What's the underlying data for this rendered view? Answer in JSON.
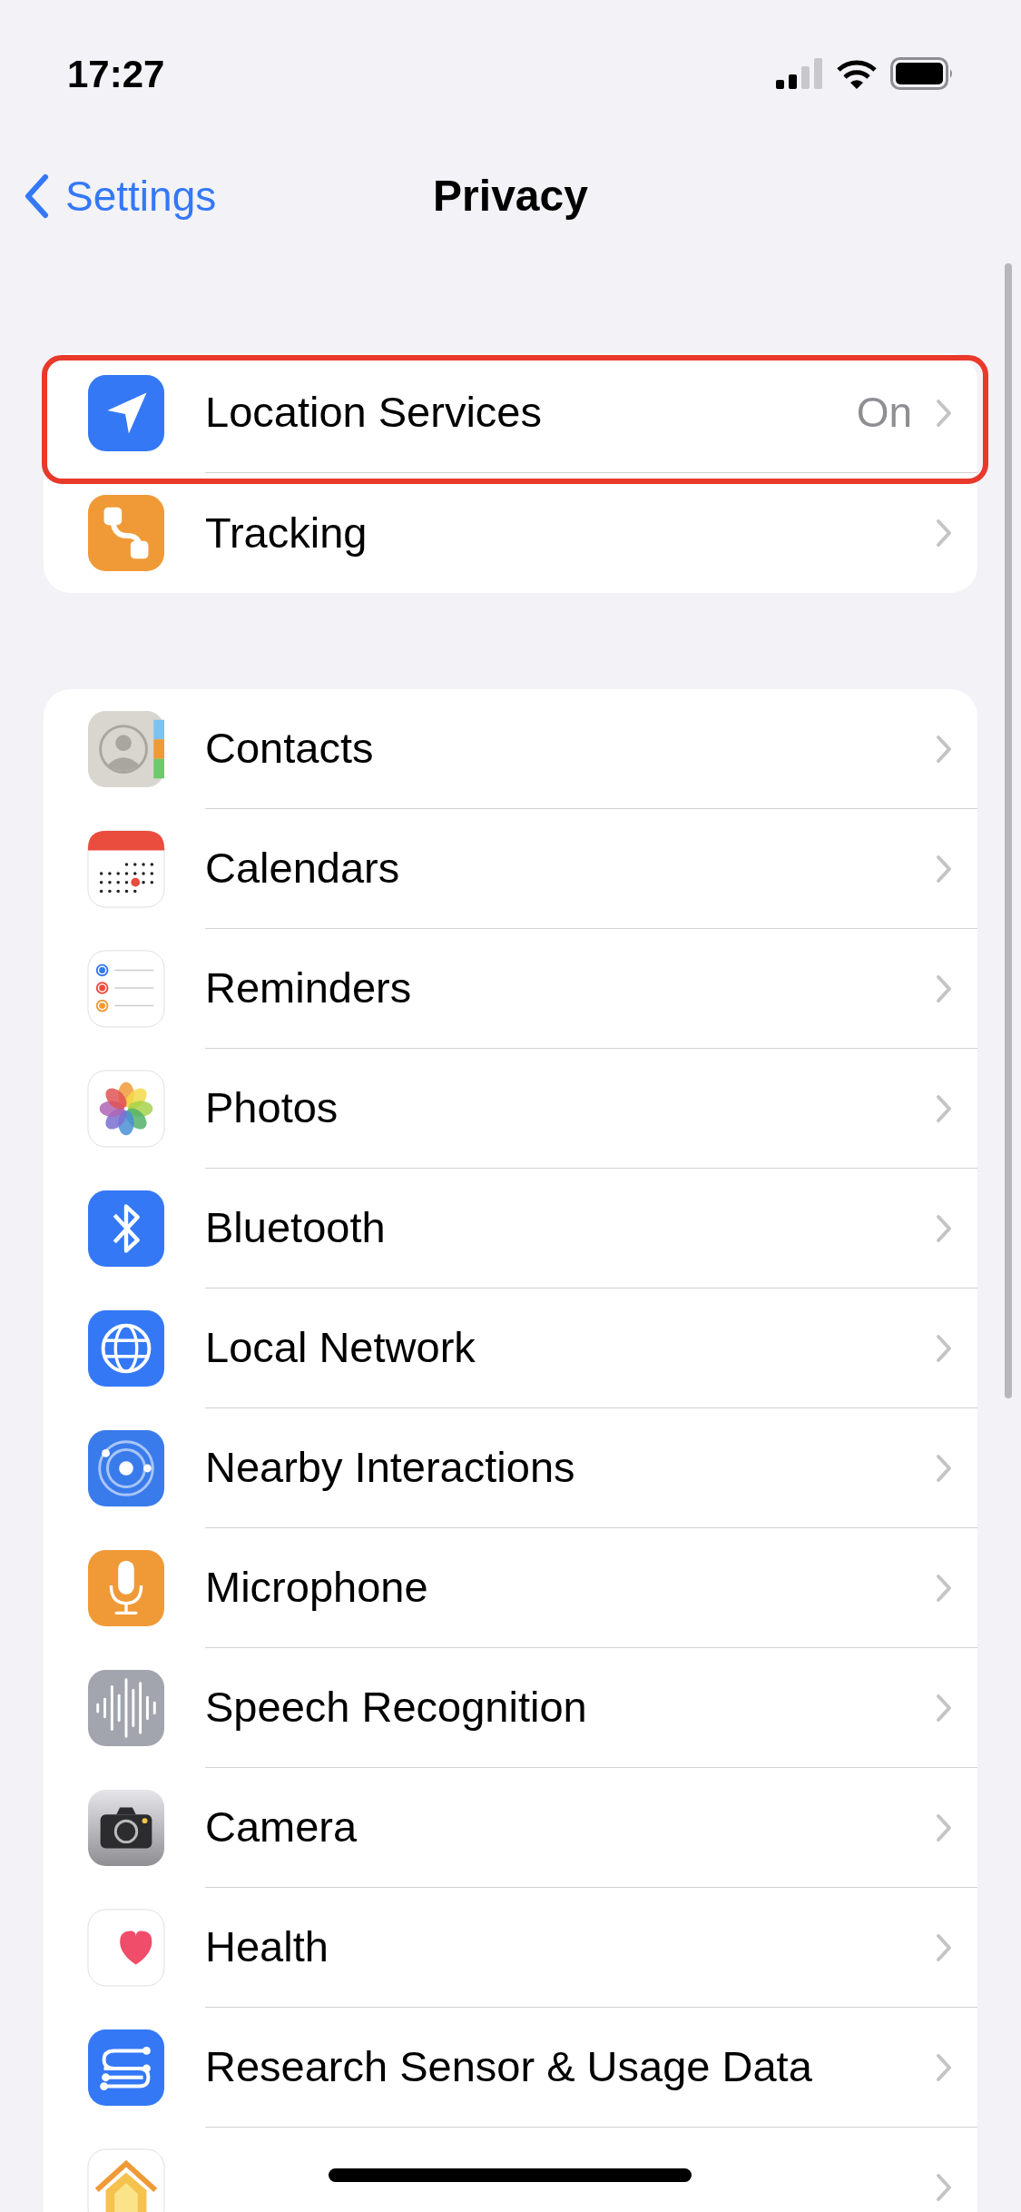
{
  "status_bar": {
    "time": "17:27"
  },
  "nav": {
    "back": "Settings",
    "title": "Privacy"
  },
  "groups": [
    {
      "rows": [
        {
          "kind": "location",
          "label": "Location Services",
          "value": "On",
          "highlighted": true
        },
        {
          "kind": "tracking",
          "label": "Tracking",
          "highlighted": false
        }
      ]
    },
    {
      "rows": [
        {
          "kind": "contacts",
          "label": "Contacts"
        },
        {
          "kind": "calendars",
          "label": "Calendars"
        },
        {
          "kind": "reminders",
          "label": "Reminders"
        },
        {
          "kind": "photos",
          "label": "Photos"
        },
        {
          "kind": "bluetooth",
          "label": "Bluetooth"
        },
        {
          "kind": "network",
          "label": "Local Network"
        },
        {
          "kind": "nearby",
          "label": "Nearby Interactions"
        },
        {
          "kind": "microphone",
          "label": "Microphone"
        },
        {
          "kind": "speech",
          "label": "Speech Recognition"
        },
        {
          "kind": "camera",
          "label": "Camera"
        },
        {
          "kind": "health",
          "label": "Health"
        },
        {
          "kind": "research",
          "label": "Research Sensor & Usage Data"
        },
        {
          "kind": "homekit"
        }
      ]
    }
  ]
}
